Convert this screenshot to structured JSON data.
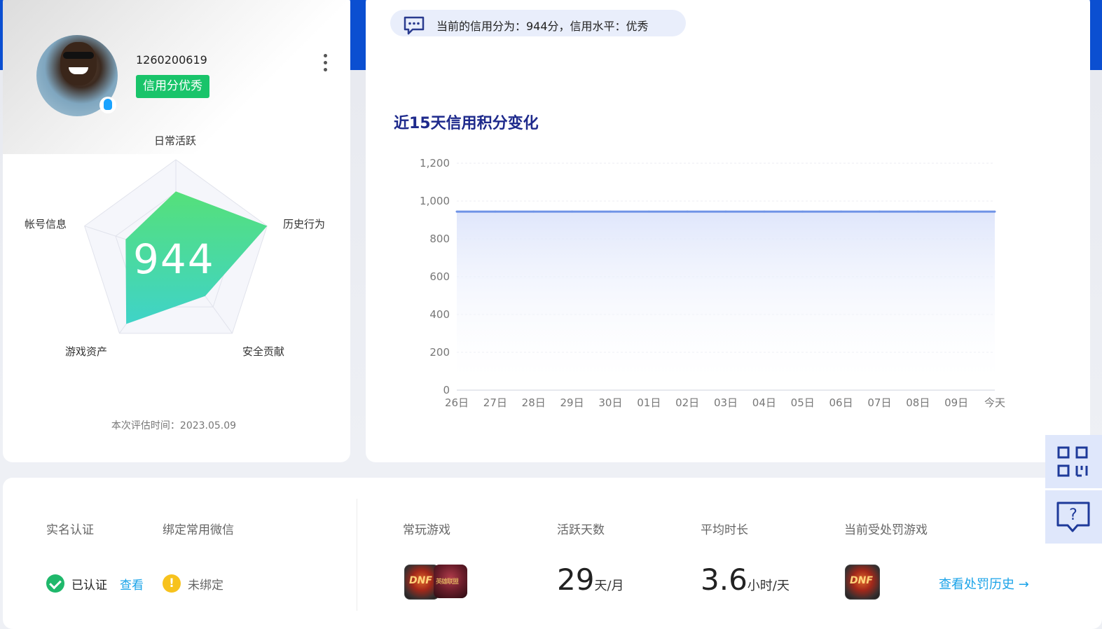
{
  "profile": {
    "uid": "1260200619",
    "credit_badge": "信用分优秀",
    "score": "944",
    "eval_time": "本次评估时间：2023.05.09",
    "radar": {
      "dimensions": [
        "日常活跃",
        "历史行为",
        "安全贡献",
        "游戏资产",
        "帐号信息"
      ],
      "values": [
        0.67,
        1.0,
        0.52,
        0.88,
        0.55
      ],
      "fill_color_top": "#55e07a",
      "fill_color_bottom": "#3fd3c8"
    }
  },
  "summary": {
    "text": "当前的信用分为：944分，信用水平：优秀"
  },
  "chart_title": "近15天信用积分变化",
  "chart_data": {
    "type": "area",
    "x": [
      "26日",
      "27日",
      "28日",
      "29日",
      "30日",
      "01日",
      "02日",
      "03日",
      "04日",
      "05日",
      "06日",
      "07日",
      "08日",
      "09日",
      "今天"
    ],
    "series": [
      {
        "values": [
          944,
          944,
          944,
          944,
          944,
          944,
          944,
          944,
          944,
          944,
          944,
          944,
          944,
          944,
          944
        ]
      }
    ],
    "yticks": [
      "0",
      "200",
      "400",
      "600",
      "800",
      "1,000",
      "1,200"
    ],
    "ylim": [
      0,
      1200
    ],
    "grid": true,
    "line_color": "#6f93e6",
    "fill_color": "#dfe6fb"
  },
  "bottom": {
    "real_name_label": "实名认证",
    "real_name_status": "已认证",
    "real_name_link": "查看",
    "wechat_label": "绑定常用微信",
    "wechat_status": "未绑定",
    "games_label": "常玩游戏",
    "active_days_label": "活跃天数",
    "active_days_value": "29",
    "active_days_unit": "天/月",
    "avg_time_label": "平均时长",
    "avg_time_value": "3.6",
    "avg_time_unit": "小时/天",
    "penalty_label": "当前受处罚游戏",
    "penalty_link": "查看处罚历史 →",
    "game_dnf_text": "DNF",
    "game_lol_text": "英雄联盟"
  },
  "icons": {
    "message": "message-icon",
    "qrcode": "qrcode-icon",
    "help": "help-icon",
    "more": "more-vertical-icon"
  }
}
